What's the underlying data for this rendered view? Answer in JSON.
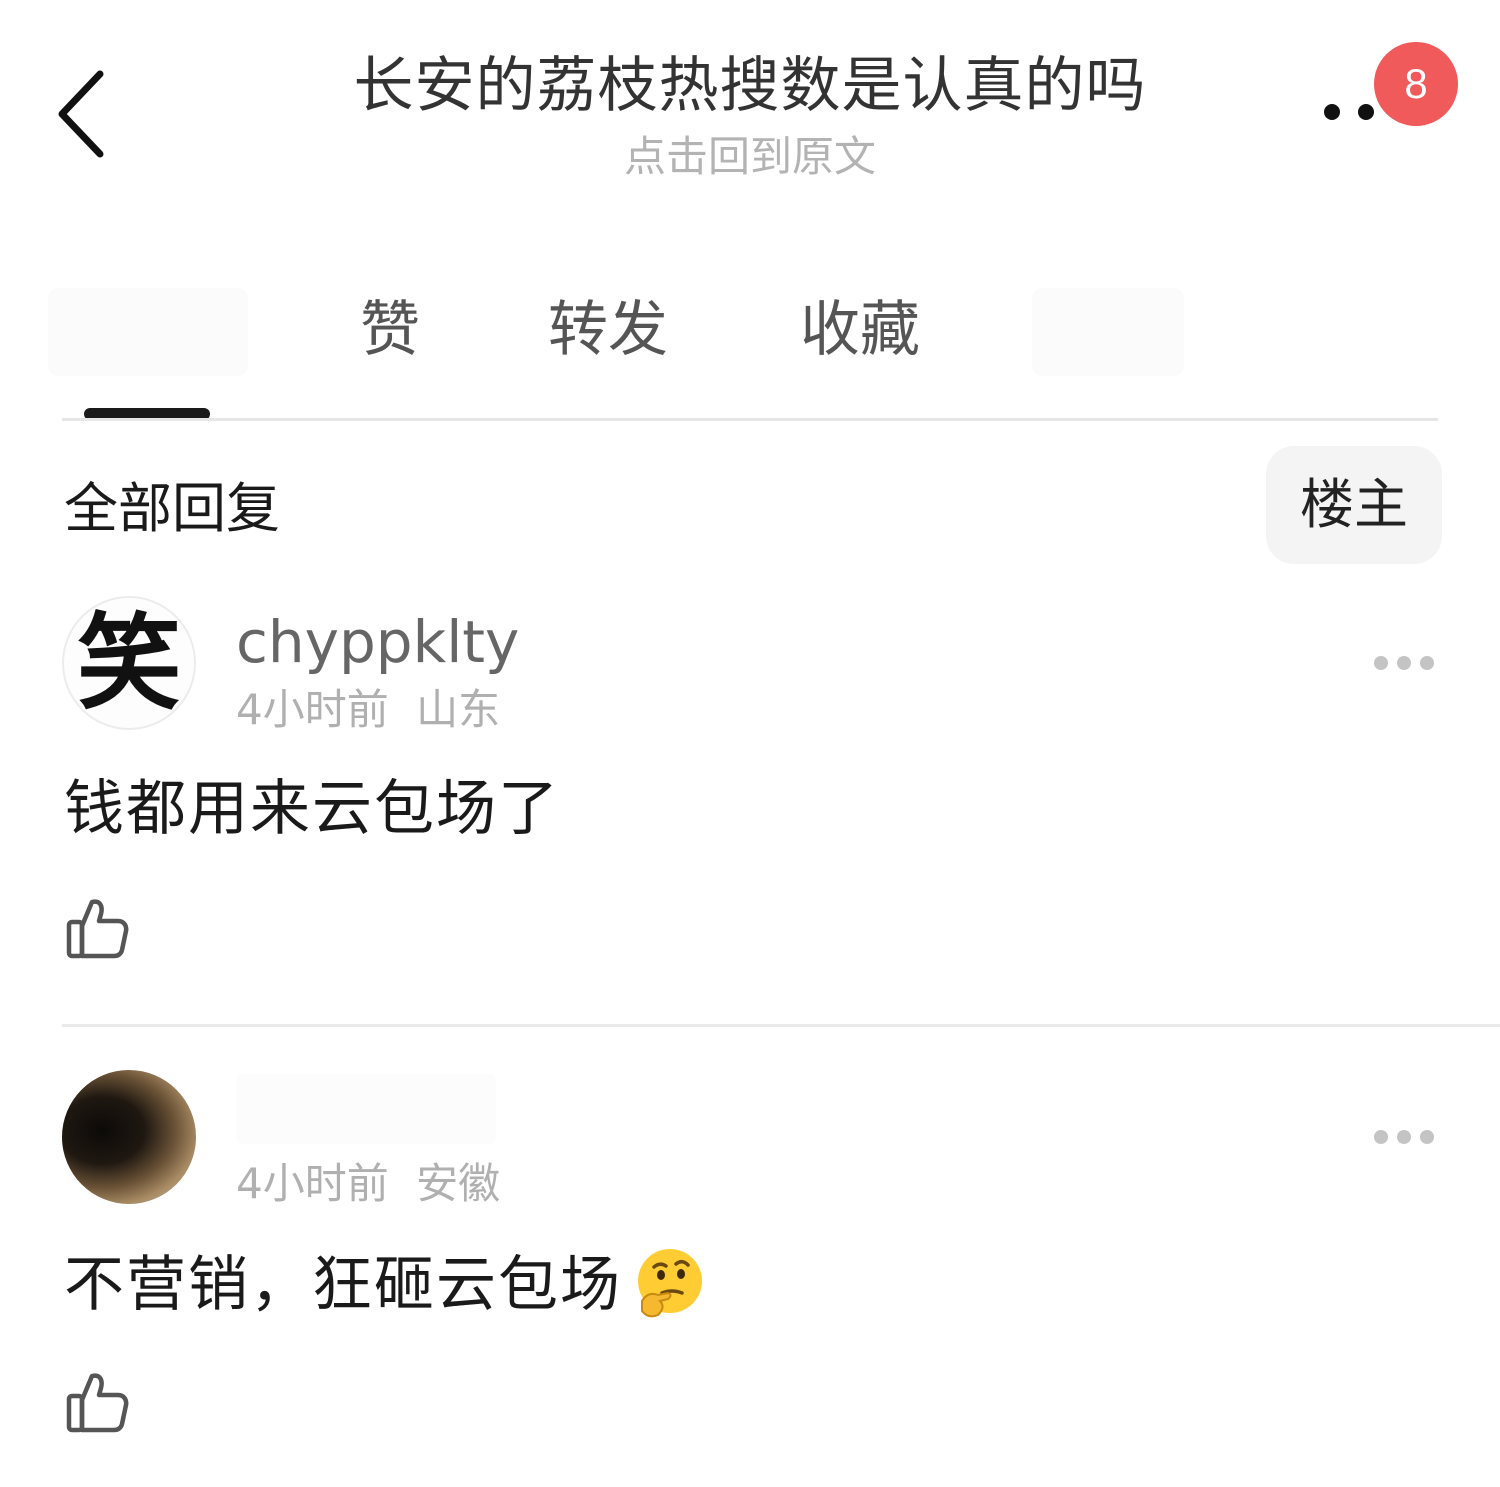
{
  "header": {
    "title": "长安的荔枝热搜数是认真的吗",
    "subtitle": "点击回到原文",
    "badge_count": "8"
  },
  "tabs": [
    {
      "label": "赞"
    },
    {
      "label": "转发"
    },
    {
      "label": "收藏"
    }
  ],
  "section": {
    "title": "全部回复",
    "filter_label": "楼主"
  },
  "comments": [
    {
      "avatar_glyph": "笑",
      "username": "chyppklty",
      "time": "4小时前",
      "location": "山东",
      "text": "钱都用来云包场了"
    },
    {
      "username": "",
      "time": "4小时前",
      "location": "安徽",
      "text": "不营销，狂砸云包场",
      "emoji": "thinking-face-icon"
    }
  ],
  "colors": {
    "badge": "#f05a5a",
    "indicator": "#1a1a1a",
    "muted_text": "#b0b0b0"
  }
}
